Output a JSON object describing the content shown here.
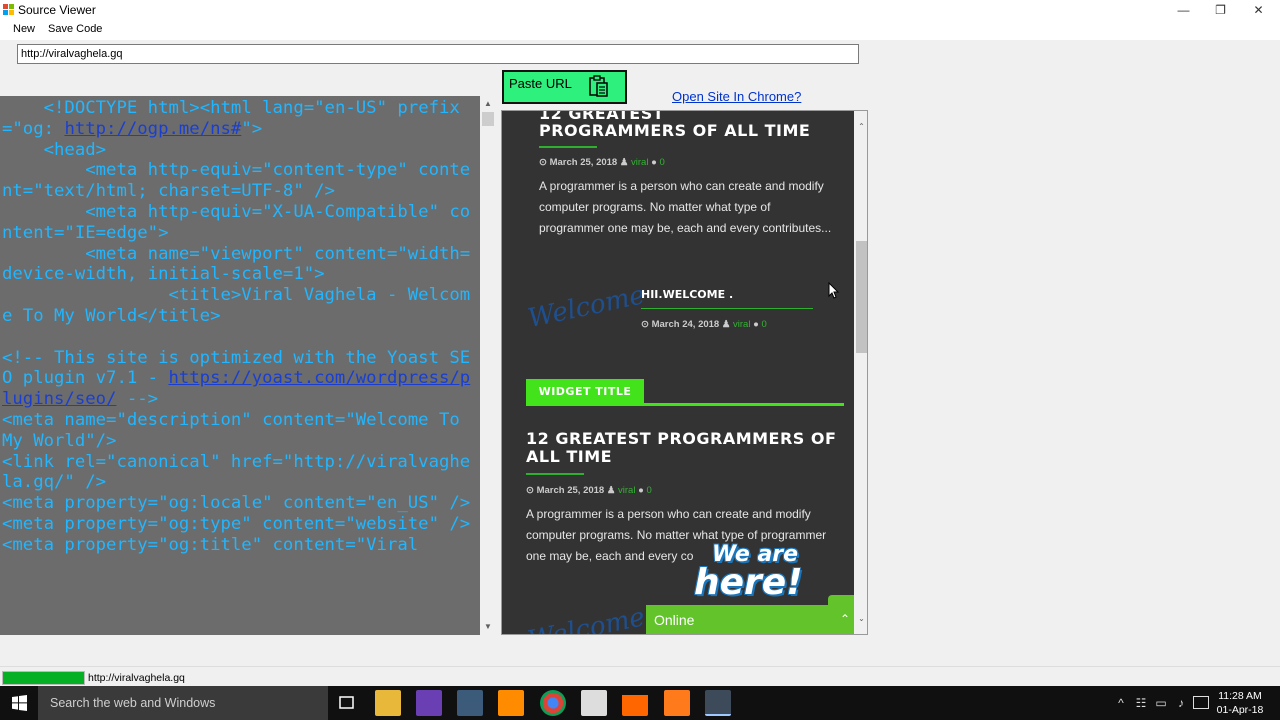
{
  "window": {
    "title": "Source Viewer",
    "controls": {
      "minimize": "—",
      "maximize": "❐",
      "close": "✕"
    }
  },
  "menu": {
    "new": "New",
    "save_code": "Save Code"
  },
  "url_field": {
    "value": "http://viralvaghela.gq"
  },
  "paste_button": {
    "label": "Paste URL",
    "icon": "clipboard-icon"
  },
  "open_chrome_link": "Open Site In Chrome?",
  "source_code": {
    "lines": [
      {
        "t": "    <!DOCTYPE html>"
      },
      {
        "t": "<html lang=\"en-US\" prefix=\"og: "
      },
      {
        "t": "http://ogp.me/ns#",
        "link": true
      },
      {
        "t": "\">"
      },
      {
        "t": "\n    <head>"
      },
      {
        "t": "\n        <meta http-equiv=\"content-type\" content=\"text/html; charset=UTF-8\" />"
      },
      {
        "t": "\n        <meta http-equiv=\"X-UA-Compatible\" content=\"IE=edge\">"
      },
      {
        "t": "\n        <meta name=\"viewport\" content=\"width=device-width, initial-scale=1\">"
      },
      {
        "t": "\n                <title>Viral Vaghela - Welcome To My World</title>"
      },
      {
        "t": "\n\n<!-- This site is optimized with the Yoast SEO plugin v7.1 - "
      },
      {
        "t": "https://yoast.com/wordpress/plugins/seo/",
        "link": true
      },
      {
        "t": " -->"
      },
      {
        "t": "\n<meta name=\"description\" content=\"Welcome To My World\"/>"
      },
      {
        "t": "\n<link rel=\"canonical\" href=\"http://viralvaghela.gq/\" />"
      },
      {
        "t": "\n<meta property=\"og:locale\" content=\"en_US\" />"
      },
      {
        "t": "\n<meta property=\"og:type\" content=\"website\" />"
      },
      {
        "t": "\n<meta property=\"og:title\" content=\"Viral"
      }
    ]
  },
  "site": {
    "post1": {
      "title_partial": "12 GREATEST",
      "title": "PROGRAMMERS OF ALL TIME",
      "date": "March 25, 2018",
      "author": "viral",
      "comments": "0",
      "excerpt": "A programmer is a person who can create and modify computer programs. No matter what type of programmer one may be, each and every contributes..."
    },
    "post2": {
      "thumb_text": "Welcome",
      "title": "HII.WELCOME .",
      "date": "March 24, 2018",
      "author": "viral",
      "comments": "0"
    },
    "widget_title": "WIDGET TITLE",
    "post3": {
      "title": "12 GREATEST PROGRAMMERS OF ALL TIME",
      "date": "March 25, 2018",
      "author": "viral",
      "comments": "0",
      "excerpt": "A programmer is a person who can create and modify computer programs. No matter what type of programmer one may be, each and every co"
    },
    "chat": {
      "line1": "We are",
      "line2": "here!",
      "status": "Online"
    }
  },
  "status_bar": {
    "progress": 1.0,
    "url": "http://viralvaghela.gq"
  },
  "taskbar": {
    "search_placeholder": "Search the web and Windows",
    "time": "11:28 AM",
    "date": "01-Apr-18"
  },
  "colors": {
    "source_text": "#21b6ff",
    "source_bg": "#6c6c6c",
    "paste_btn": "#2ef07c",
    "accent_green": "#43e31c",
    "chat_green": "#63c32b"
  }
}
